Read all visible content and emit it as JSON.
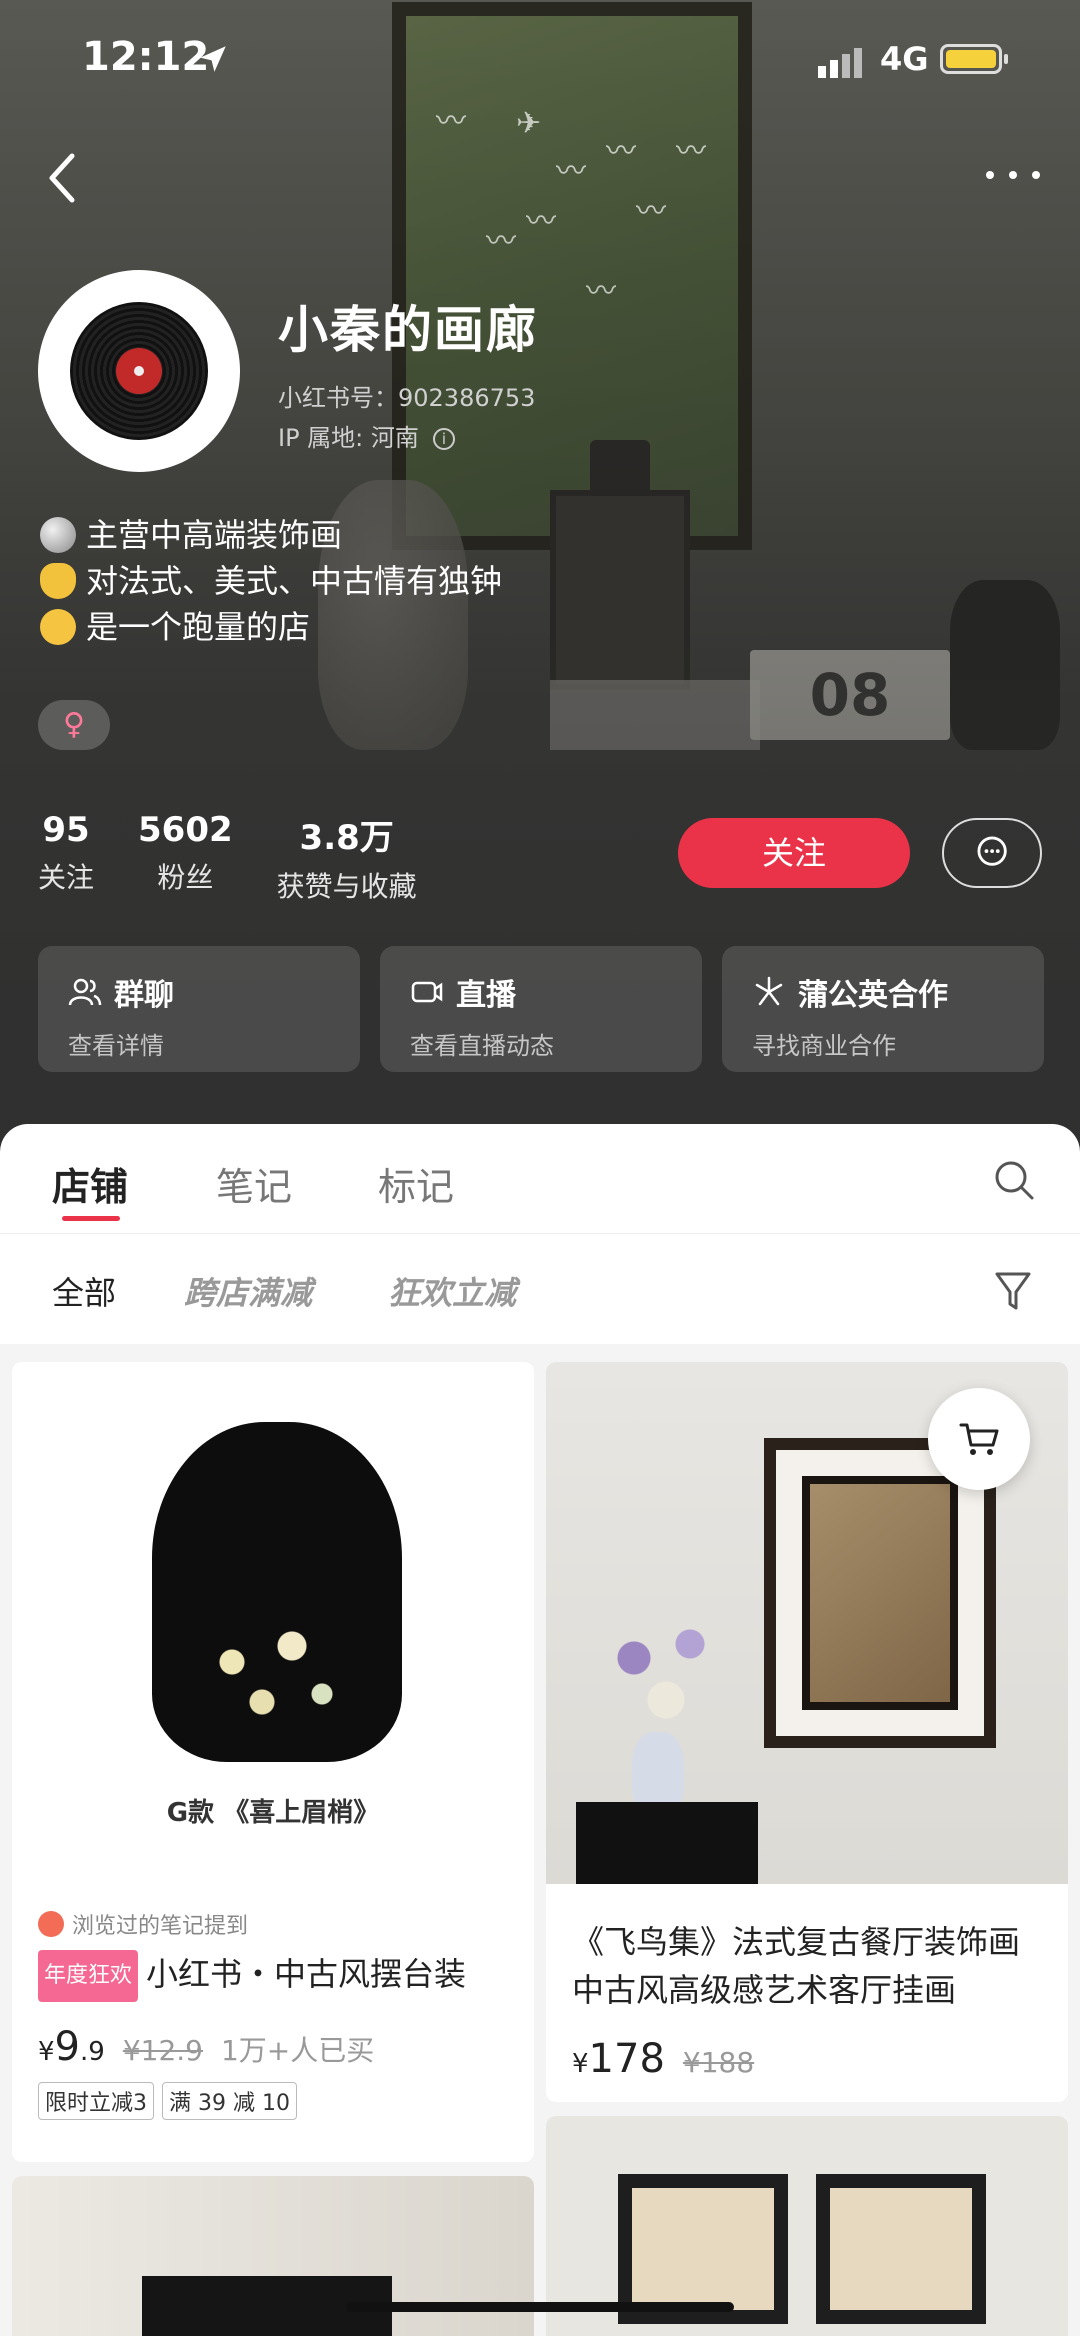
{
  "status_bar": {
    "time": "12:12",
    "network": "4G"
  },
  "profile": {
    "name": "小秦的画廊",
    "xhs_id": "小红书号：902386753",
    "ip": "IP 属地: 河南",
    "bio": [
      "主营中高端装饰画",
      "对法式、美式、中古情有独钟",
      "是一个跑量的店"
    ],
    "gender_symbol": "♀"
  },
  "stats": [
    {
      "num": "95",
      "label": "关注"
    },
    {
      "num": "5602",
      "label": "粉丝"
    },
    {
      "num": "3.8万",
      "label": "获赞与收藏"
    }
  ],
  "actions": {
    "follow": "关注"
  },
  "cards": [
    {
      "title": "群聊",
      "sub": "查看详情",
      "icon": "group-icon"
    },
    {
      "title": "直播",
      "sub": "查看直播动态",
      "icon": "live-icon"
    },
    {
      "title": "蒲公英合作",
      "sub": "寻找商业合作",
      "icon": "dandelion-icon"
    }
  ],
  "tabs": [
    "店铺",
    "笔记",
    "标记"
  ],
  "filters": [
    "全部",
    "跨店满减",
    "狂欢立减"
  ],
  "products": [
    {
      "image_caption": "G款 《喜上眉梢》",
      "viewed": "浏览过的笔记提到",
      "badge": "年度狂欢",
      "title": "小红书・中古风摆台装",
      "yen": "¥",
      "price_int": "9",
      "price_dec": ".9",
      "old_price": "¥12.9",
      "sold": "1万+人已买",
      "coupons": [
        "限时立减3",
        "满 39 减 10"
      ]
    },
    {
      "title": "《飞鸟集》法式复古餐厅装饰画中古风高级感艺术客厅挂画",
      "yen": "¥",
      "price": "178",
      "old_price": "¥188"
    }
  ],
  "colors": {
    "accent": "#ea3348",
    "badge": "#f56893"
  }
}
